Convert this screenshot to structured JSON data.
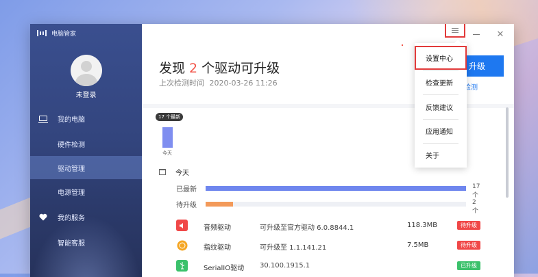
{
  "window": {
    "title": "电脑管家"
  },
  "user": {
    "login_label": "未登录"
  },
  "sidebar": {
    "groups": [
      {
        "label": "我的电脑",
        "icon": "monitor-icon",
        "items": [
          "硬件检测",
          "驱动管理",
          "电源管理"
        ]
      },
      {
        "label": "我的服务",
        "icon": "heart-icon",
        "items": [
          "智能客服"
        ]
      }
    ],
    "active_item": "驱动管理"
  },
  "summary": {
    "title_prefix": "发现",
    "count": "2",
    "title_suffix": "个驱动可升级",
    "last_check_label": "上次检测时间",
    "last_check_value": "2020-03-26 11:26"
  },
  "actions": {
    "upgrade_partial": "升级",
    "recheck_partial": "检测"
  },
  "chart": {
    "bar_label": "17 个最新",
    "category": "今天"
  },
  "today": {
    "label": "今天",
    "rows": [
      {
        "label": "已最新",
        "count": "17个",
        "fraction": 1.0,
        "color": "#6f86ee"
      },
      {
        "label": "待升级",
        "count": "2个",
        "fraction": 0.105,
        "color": "#f39a5a"
      }
    ]
  },
  "drivers": [
    {
      "name": "音频驱动",
      "desc": "可升级至官方驱动 6.0.8844.1",
      "size": "118.3MB",
      "badge": "待升级",
      "badge_color": "#f04848",
      "icon": "speaker-icon",
      "icon_color": "#f04848"
    },
    {
      "name": "指纹驱动",
      "desc": "可升级至 1.1.141.21",
      "size": "7.5MB",
      "badge": "待升级",
      "badge_color": "#f04848",
      "icon": "fingerprint-icon",
      "icon_color": "#f5a623"
    },
    {
      "name": "SerialIO驱动",
      "desc": "30.100.1915.1",
      "size": "",
      "badge": "已升级",
      "badge_color": "#3bc16b",
      "icon": "usb-icon",
      "icon_color": "#3bc16b"
    }
  ],
  "menu": {
    "items": [
      "设置中心",
      "检查更新",
      "反馈建议",
      "应用通知",
      "关于"
    ],
    "highlighted": "设置中心"
  },
  "icons": {
    "menu": "hamburger-icon",
    "minimize": "minimize-icon",
    "close": "close-icon",
    "close_glyph": "✕"
  }
}
